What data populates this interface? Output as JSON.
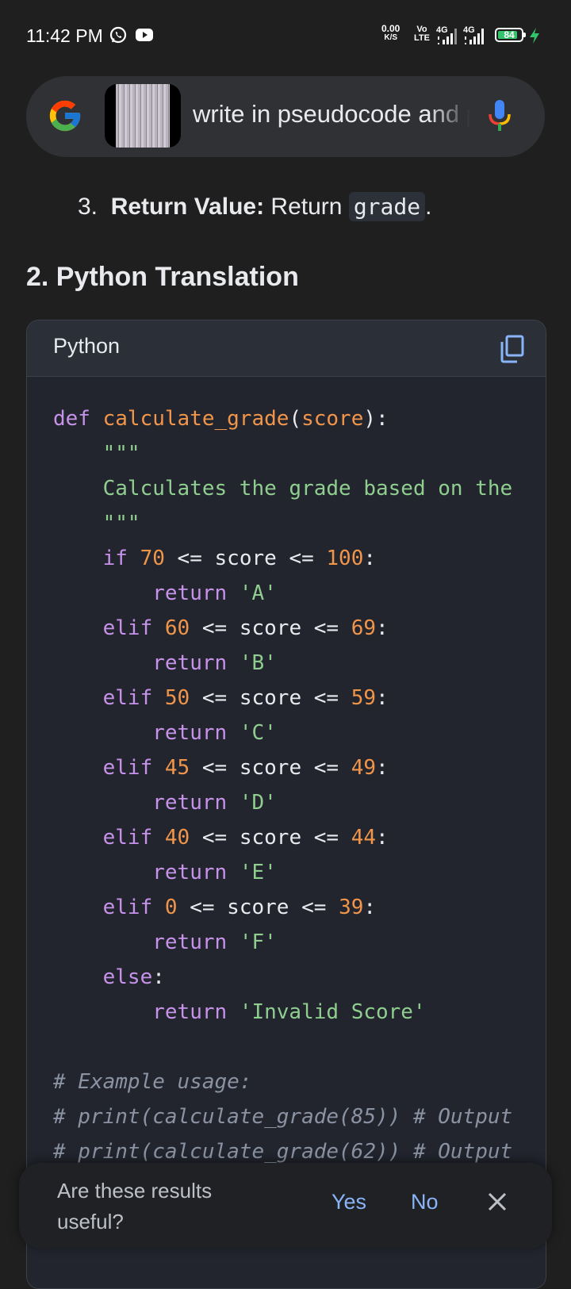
{
  "status_bar": {
    "time": "11:42 PM",
    "net_speed_value": "0.00",
    "net_speed_unit": "K/S",
    "volte_top": "Vo",
    "volte_bottom": "LTE",
    "sim1": "4G",
    "sim2": "4G",
    "battery": "84",
    "battery_level": 0.84,
    "icons": [
      "whatsapp-icon",
      "youtube-icon",
      "signal-icon",
      "battery-icon",
      "charging-icon"
    ]
  },
  "search": {
    "query": "write in pseudocode and python",
    "icons": [
      "google-logo-icon",
      "mic-icon"
    ]
  },
  "list_item": {
    "number": "3.",
    "label": "Return Value:",
    "text": "Return",
    "code": "grade",
    "end": "."
  },
  "section_heading": "2. Python Translation",
  "code_block": {
    "language": "Python",
    "copy_icon": "copy-icon",
    "lines": [
      [
        {
          "t": "def",
          "c": "kw"
        },
        {
          "t": " "
        },
        {
          "t": "calculate_grade",
          "c": "fn"
        },
        {
          "t": "("
        },
        {
          "t": "score",
          "c": "fn"
        },
        {
          "t": "):"
        }
      ],
      [
        {
          "t": "    "
        },
        {
          "t": "\"\"\"",
          "c": "str"
        }
      ],
      [
        {
          "t": "    "
        },
        {
          "t": "Calculates the grade based on the",
          "c": "str"
        }
      ],
      [
        {
          "t": "    "
        },
        {
          "t": "\"\"\"",
          "c": "str"
        }
      ],
      [
        {
          "t": "    "
        },
        {
          "t": "if",
          "c": "kw"
        },
        {
          "t": " "
        },
        {
          "t": "70",
          "c": "num"
        },
        {
          "t": " <= score <= "
        },
        {
          "t": "100",
          "c": "num"
        },
        {
          "t": ":"
        }
      ],
      [
        {
          "t": "        "
        },
        {
          "t": "return",
          "c": "kw"
        },
        {
          "t": " "
        },
        {
          "t": "'A'",
          "c": "str"
        }
      ],
      [
        {
          "t": "    "
        },
        {
          "t": "elif",
          "c": "kw"
        },
        {
          "t": " "
        },
        {
          "t": "60",
          "c": "num"
        },
        {
          "t": " <= score <= "
        },
        {
          "t": "69",
          "c": "num"
        },
        {
          "t": ":"
        }
      ],
      [
        {
          "t": "        "
        },
        {
          "t": "return",
          "c": "kw"
        },
        {
          "t": " "
        },
        {
          "t": "'B'",
          "c": "str"
        }
      ],
      [
        {
          "t": "    "
        },
        {
          "t": "elif",
          "c": "kw"
        },
        {
          "t": " "
        },
        {
          "t": "50",
          "c": "num"
        },
        {
          "t": " <= score <= "
        },
        {
          "t": "59",
          "c": "num"
        },
        {
          "t": ":"
        }
      ],
      [
        {
          "t": "        "
        },
        {
          "t": "return",
          "c": "kw"
        },
        {
          "t": " "
        },
        {
          "t": "'C'",
          "c": "str"
        }
      ],
      [
        {
          "t": "    "
        },
        {
          "t": "elif",
          "c": "kw"
        },
        {
          "t": " "
        },
        {
          "t": "45",
          "c": "num"
        },
        {
          "t": " <= score <= "
        },
        {
          "t": "49",
          "c": "num"
        },
        {
          "t": ":"
        }
      ],
      [
        {
          "t": "        "
        },
        {
          "t": "return",
          "c": "kw"
        },
        {
          "t": " "
        },
        {
          "t": "'D'",
          "c": "str"
        }
      ],
      [
        {
          "t": "    "
        },
        {
          "t": "elif",
          "c": "kw"
        },
        {
          "t": " "
        },
        {
          "t": "40",
          "c": "num"
        },
        {
          "t": " <= score <= "
        },
        {
          "t": "44",
          "c": "num"
        },
        {
          "t": ":"
        }
      ],
      [
        {
          "t": "        "
        },
        {
          "t": "return",
          "c": "kw"
        },
        {
          "t": " "
        },
        {
          "t": "'E'",
          "c": "str"
        }
      ],
      [
        {
          "t": "    "
        },
        {
          "t": "elif",
          "c": "kw"
        },
        {
          "t": " "
        },
        {
          "t": "0",
          "c": "num"
        },
        {
          "t": " <= score <= "
        },
        {
          "t": "39",
          "c": "num"
        },
        {
          "t": ":"
        }
      ],
      [
        {
          "t": "        "
        },
        {
          "t": "return",
          "c": "kw"
        },
        {
          "t": " "
        },
        {
          "t": "'F'",
          "c": "str"
        }
      ],
      [
        {
          "t": "    "
        },
        {
          "t": "else",
          "c": "kw"
        },
        {
          "t": ":"
        }
      ],
      [
        {
          "t": "        "
        },
        {
          "t": "return",
          "c": "kw"
        },
        {
          "t": " "
        },
        {
          "t": "'Invalid Score'",
          "c": "str"
        }
      ],
      [
        {
          "t": ""
        }
      ],
      [
        {
          "t": "# Example usage:",
          "c": "cm"
        }
      ],
      [
        {
          "t": "# print(calculate_grade(85)) # Output",
          "c": "cm"
        }
      ],
      [
        {
          "t": "# print(calculate_grade(62)) # Output",
          "c": "cm"
        }
      ]
    ]
  },
  "feedback": {
    "question": "Are these results useful?",
    "yes": "Yes",
    "no": "No",
    "close_icon": "close-icon"
  },
  "colors": {
    "background": "#1f1f1f",
    "code_bg": "#22252e",
    "keyword": "#c792ea",
    "number": "#f0954a",
    "string": "#8fce8f",
    "comment": "#8b93a3",
    "link": "#8ab4f8"
  }
}
